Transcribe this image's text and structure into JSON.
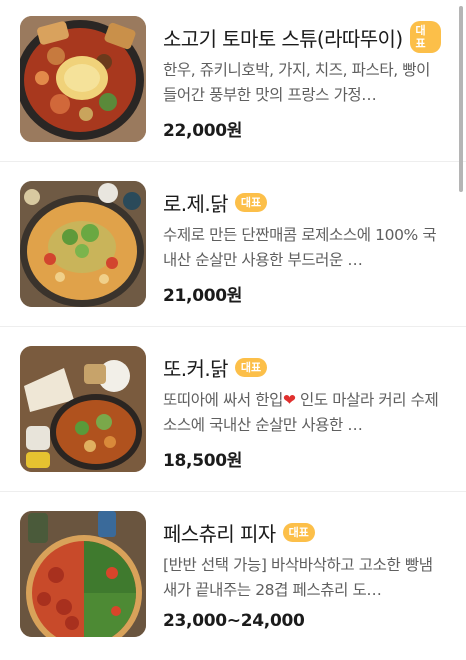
{
  "menu": {
    "items": [
      {
        "name": "소고기 토마토 스튜(라따뚜이)",
        "badge": "대표",
        "description": "한우, 쥬키니호박, 가지, 치즈, 파스타, 빵이 들어간 풍부한 맛의 프랑스 가정…",
        "price": "22,000원",
        "image": "beef-tomato-stew-photo"
      },
      {
        "name": "로.제.닭",
        "badge": "대표",
        "description": "수제로 만든 단짠매콤 로제소스에 100% 국내산 순살만 사용한 부드러운 …",
        "price": "21,000원",
        "image": "rose-chicken-photo"
      },
      {
        "name": "또.커.닭",
        "badge": "대표",
        "description_before": "또띠아에 싸서 한입",
        "description_icon": "red-heart-icon",
        "description_after": " 인도 마살라 커리 수제소스에 국내산 순살만 사용한 …",
        "price": "18,500원",
        "image": "curry-chicken-tortilla-photo"
      },
      {
        "name": "페스츄리 피자",
        "badge": "대표",
        "description": "[반반 선택 가능] 바삭바삭하고 고소한 빵냄새가 끝내주는 28겹 페스츄리 도…",
        "price": "23,000~24,000",
        "image": "pastry-pizza-photo"
      }
    ]
  },
  "colors": {
    "badge": "#fcbf49",
    "heart": "#e0302e",
    "divider": "#eeeeee"
  }
}
